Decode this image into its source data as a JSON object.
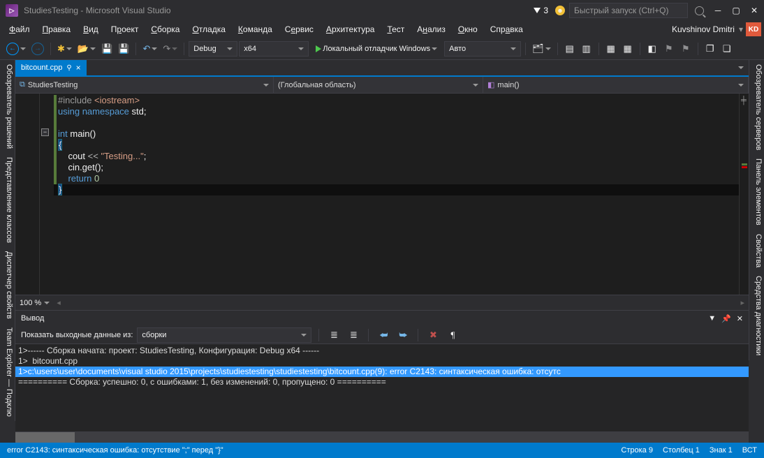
{
  "title_bar": {
    "text": "StudiesTesting - Microsoft Visual Studio",
    "notif_count": "3",
    "quick_launch_placeholder": "Быстрый запуск (Ctrl+Q)"
  },
  "menu": {
    "items": [
      "Файл",
      "Правка",
      "Вид",
      "Проект",
      "Сборка",
      "Отладка",
      "Команда",
      "Сервис",
      "Архитектура",
      "Тест",
      "Анализ",
      "Окно",
      "Справка"
    ],
    "user": "Kuvshinov Dmitri",
    "badge": "KD"
  },
  "toolbar": {
    "config": "Debug",
    "platform": "x64",
    "debug_btn": "Локальный отладчик Windows",
    "auto": "Авто"
  },
  "tab": {
    "filename": "bitcount.cpp"
  },
  "context": {
    "project": "StudiesTesting",
    "scope": "(Глобальная область)",
    "func": "main()"
  },
  "code": {
    "l1_pp": "#include ",
    "l1_inc": "<iostream>",
    "l2_a": "using",
    "l2_b": "namespace",
    "l2_c": "std",
    "l3_a": "int",
    "l3_b": "main()",
    "l4": "{",
    "l5_a": "cout ",
    "l5_op": "<<",
    "l5_str": " \"Testing...\"",
    "l6": "cin.get();",
    "l7_a": "return",
    "l7_b": "0",
    "l8": "}"
  },
  "zoom": "100 %",
  "output": {
    "title": "Вывод",
    "source_label": "Показать выходные данные из:",
    "source": "сборки",
    "l1": "1>------ Сборка начата: проект: StudiesTesting, Конфигурация: Debug x64 ------",
    "l2": "1>  bitcount.cpp",
    "l3": "1>c:\\users\\user\\documents\\visual studio 2015\\projects\\studiestesting\\studiestesting\\bitcount.cpp(9): error C2143: синтаксическая ошибка: отсутс",
    "l4": "========== Сборка: успешно: 0, с ошибками: 1, без изменений: 0, пропущено: 0 =========="
  },
  "status": {
    "err": "error C2143: синтаксическая ошибка: отсутствие \";\" перед \"}\"",
    "line": "Строка 9",
    "col": "Столбец 1",
    "char": "Знак 1",
    "ins": "ВСТ"
  },
  "side_left": [
    "Обозреватель решений",
    "Представление классов",
    "Диспетчер свойств",
    "Team Explorer — Подклю"
  ],
  "side_right": [
    "Обозреватель серверов",
    "Панель элементов",
    "Свойства",
    "Средства диагностики"
  ]
}
